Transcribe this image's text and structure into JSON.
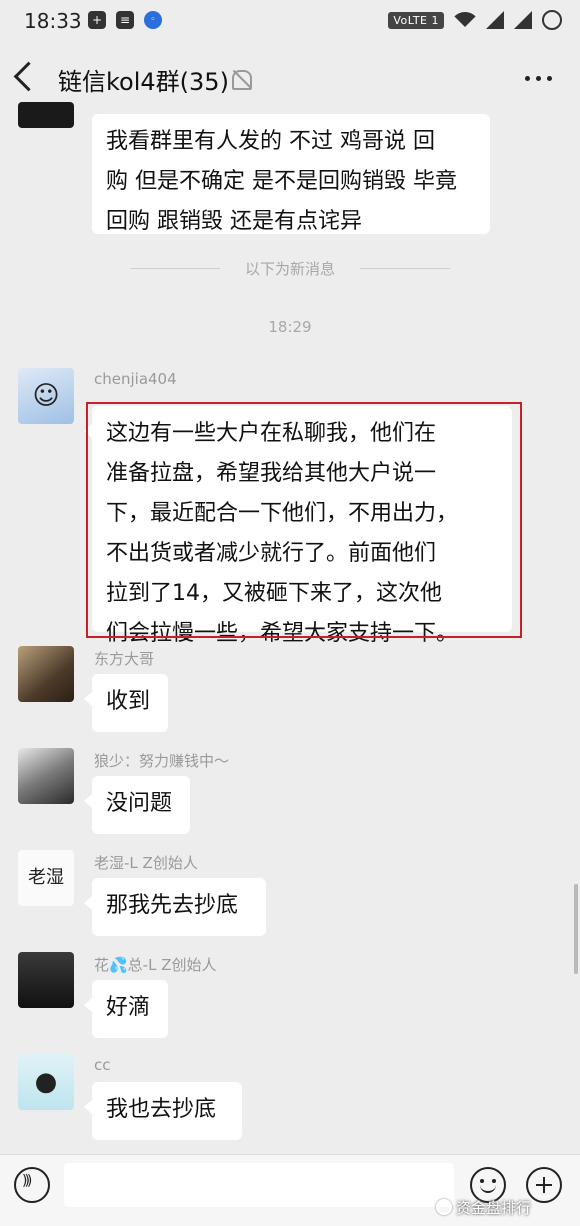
{
  "status_bar": {
    "time": "18:33",
    "network_label": "VoLTE 1"
  },
  "header": {
    "title": "链信kol4群(35)"
  },
  "chat": {
    "first_message": {
      "text": "我看群里有人发的 不过 鸡哥说 回\n购 但是不确定 是不是回购销毁 毕竟\n回购 跟销毁 还是有点诧异"
    },
    "new_messages_divider": "以下为新消息",
    "timestamp": "18:29",
    "messages": [
      {
        "sender": "chenjia404",
        "text": "这边有一些大户在私聊我，他们在\n准备拉盘，希望我给其他大户说一\n下，最近配合一下他们，不用出力，\n不出货或者减少就行了。前面他们\n拉到了14，又被砸下来了，这次他\n们会拉慢一些，希望大家支持一下。",
        "highlighted": true
      },
      {
        "sender": "东方大哥",
        "text": "收到"
      },
      {
        "sender": "狼少：努力赚钱中～",
        "text": "没问题"
      },
      {
        "sender": "老湿-L Z创始人",
        "text": "那我先去抄底",
        "avatar_text": "老湿"
      },
      {
        "sender": "花💦总-L Z创始人",
        "text": "好滴"
      },
      {
        "sender": "cc",
        "text": "我也去抄底"
      }
    ]
  },
  "watermark": "资金盘排行",
  "colors": {
    "highlight_border": "#c8202a",
    "chat_background": "#ededed",
    "bubble": "#ffffff"
  }
}
